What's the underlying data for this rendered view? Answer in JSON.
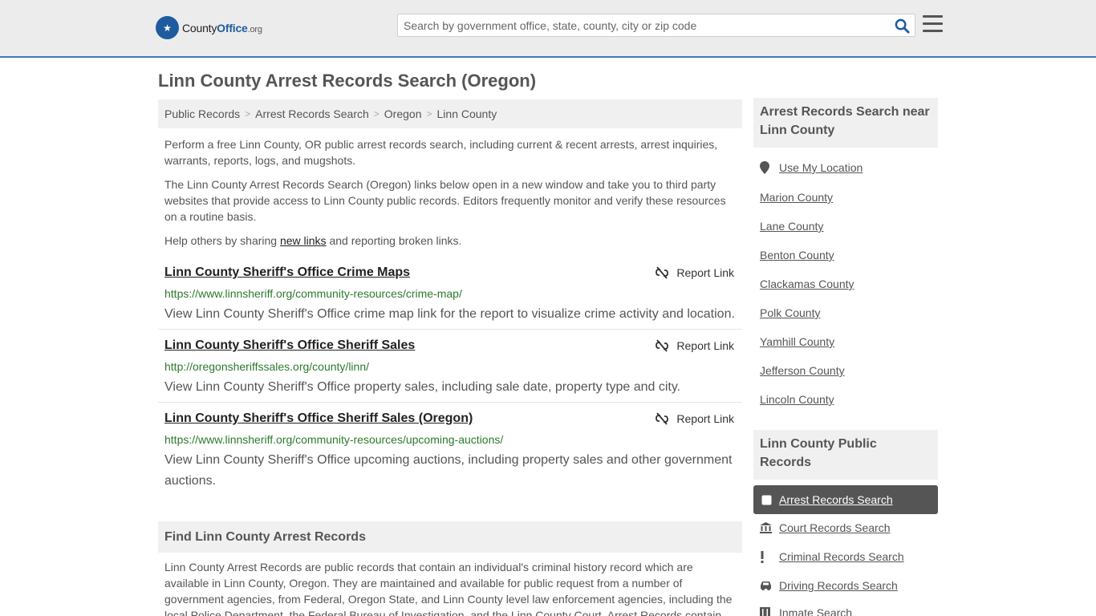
{
  "header": {
    "logo_prefix": "County",
    "logo_bold": "Office",
    "logo_suffix": ".org",
    "search_placeholder": "Search by government office, state, county, city or zip code"
  },
  "page": {
    "title": "Linn County Arrest Records Search (Oregon)",
    "breadcrumb": [
      "Public Records",
      "Arrest Records Search",
      "Oregon",
      "Linn County"
    ],
    "intro": [
      "Perform a free Linn County, OR public arrest records search, including current & recent arrests, arrest inquiries, warrants, reports, logs, and mugshots.",
      "The Linn County Arrest Records Search (Oregon) links below open in a new window and take you to third party websites that provide access to Linn County public records. Editors frequently monitor and verify these resources on a routine basis."
    ],
    "help_prefix": "Help others by sharing ",
    "help_link": "new links",
    "help_suffix": " and reporting broken links."
  },
  "results": [
    {
      "title": "Linn County Sheriff's Office Crime Maps",
      "url": "https://www.linnsheriff.org/community-resources/crime-map/",
      "desc": "View Linn County Sheriff's Office crime map link for the report to visualize crime activity and location.",
      "report": "Report Link"
    },
    {
      "title": "Linn County Sheriff's Office Sheriff Sales",
      "url": "http://oregonsheriffssales.org/county/linn/",
      "desc": "View Linn County Sheriff's Office property sales, including sale date, property type and city.",
      "report": "Report Link"
    },
    {
      "title": "Linn County Sheriff's Office Sheriff Sales (Oregon)",
      "url": "https://www.linnsheriff.org/community-resources/upcoming-auctions/",
      "desc": "View Linn County Sheriff's Office upcoming auctions, including property sales and other government auctions.",
      "report": "Report Link"
    }
  ],
  "find": {
    "heading": "Find Linn County Arrest Records",
    "text": "Linn County Arrest Records are public records that contain an individual's criminal history record which are available in Linn County, Oregon. They are maintained and available for public request from a number of government agencies, from Federal, Oregon State, and Linn County level law enforcement agencies, including the local Police Department, the Federal Bureau of Investigation, and the Linn County Court. Arrest Records contain"
  },
  "sidebar": {
    "near_heading": "Arrest Records Search near Linn County",
    "use_location": "Use My Location",
    "near": [
      "Marion County",
      "Lane County",
      "Benton County",
      "Clackamas County",
      "Polk County",
      "Yamhill County",
      "Jefferson County",
      "Lincoln County"
    ],
    "public_heading": "Linn County Public Records",
    "active": "Arrest Records Search",
    "records": [
      {
        "label": "Court Records Search",
        "icon": "courthouse-icon"
      },
      {
        "label": "Criminal Records Search",
        "icon": "exclamation-icon"
      },
      {
        "label": "Driving Records Search",
        "icon": "car-icon"
      },
      {
        "label": "Inmate Search",
        "icon": "jail-icon"
      }
    ]
  }
}
